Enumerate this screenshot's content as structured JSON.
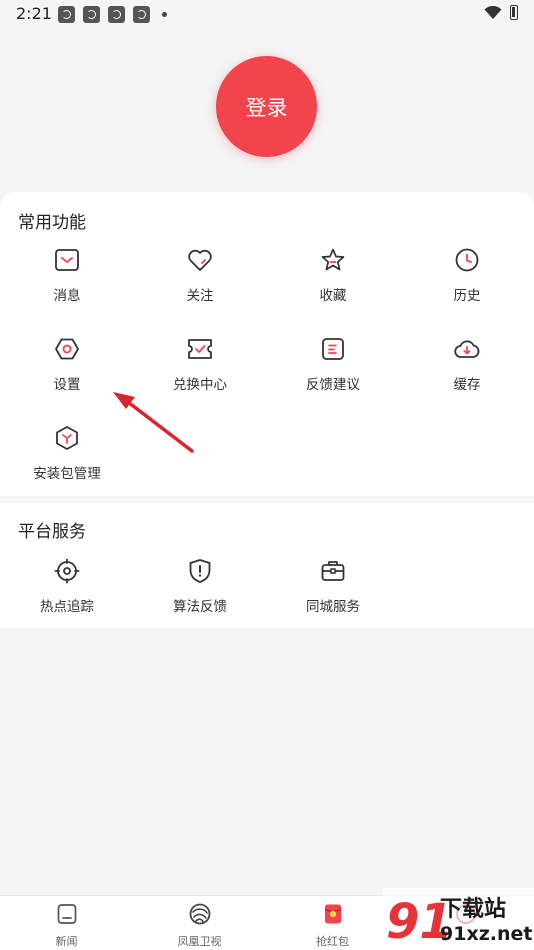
{
  "status_bar": {
    "time": "2:21",
    "icons": [
      "notification-icon",
      "notification-icon",
      "notification-icon",
      "notification-icon",
      "dot-icon",
      "wifi-icon",
      "battery-icon"
    ]
  },
  "login": {
    "label": "登录",
    "color": "#f2444c"
  },
  "common_functions": {
    "title": "常用功能",
    "items": [
      {
        "label": "消息",
        "icon": "message-icon"
      },
      {
        "label": "关注",
        "icon": "heart-icon"
      },
      {
        "label": "收藏",
        "icon": "star-icon"
      },
      {
        "label": "历史",
        "icon": "clock-icon"
      },
      {
        "label": "设置",
        "icon": "settings-icon"
      },
      {
        "label": "兑换中心",
        "icon": "ticket-icon"
      },
      {
        "label": "反馈建议",
        "icon": "feedback-icon"
      },
      {
        "label": "缓存",
        "icon": "cloud-download-icon"
      },
      {
        "label": "安装包管理",
        "icon": "package-icon"
      }
    ]
  },
  "platform_services": {
    "title": "平台服务",
    "items": [
      {
        "label": "热点追踪",
        "icon": "target-icon"
      },
      {
        "label": "算法反馈",
        "icon": "shield-alert-icon"
      },
      {
        "label": "同城服务",
        "icon": "briefcase-icon"
      }
    ]
  },
  "bottom_nav": {
    "items": [
      {
        "label": "新闻",
        "icon": "news-icon"
      },
      {
        "label": "凤凰卫视",
        "icon": "phoenix-icon"
      },
      {
        "label": "抢红包",
        "icon": "red-packet-icon"
      },
      {
        "label": "",
        "icon": "profile-icon"
      }
    ]
  },
  "watermark": {
    "text_top": "下载站",
    "text_bottom": "91xz.net",
    "logo": "91"
  },
  "colors": {
    "accent": "#f2444c",
    "icon_stroke": "#333333",
    "background": "#f5f5f5",
    "arrow": "#d9262e"
  }
}
